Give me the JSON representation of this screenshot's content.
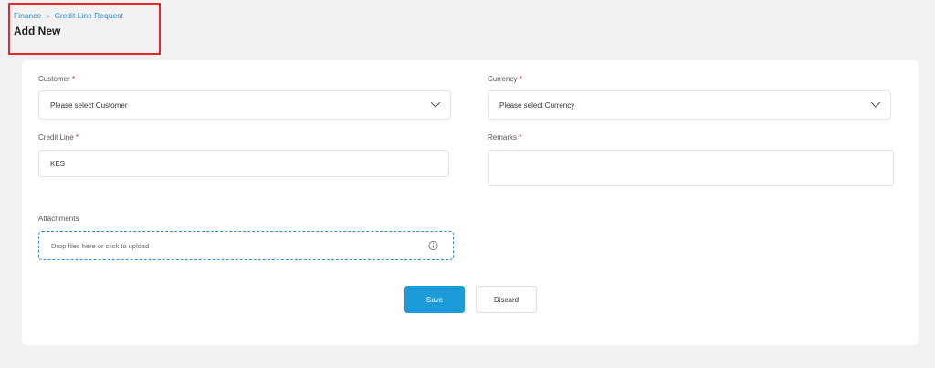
{
  "breadcrumb": {
    "root": "Finance",
    "separator": "»",
    "current": "Credit Line Request"
  },
  "page": {
    "title": "Add New"
  },
  "form": {
    "customer": {
      "label": "Customer",
      "required": "*",
      "value": "Please select Customer"
    },
    "currency": {
      "label": "Currency",
      "required": "*",
      "value": "Please select Currency"
    },
    "credit_line": {
      "label": "Credit Line",
      "required": "*",
      "value": "KES"
    },
    "remarks": {
      "label": "Remarks",
      "required": "*",
      "value": ""
    },
    "attachments": {
      "label": "Attachments",
      "placeholder": "Drop files here or click to upload",
      "icon": "info-icon"
    }
  },
  "actions": {
    "save": "Save",
    "discard": "Discard"
  },
  "colors": {
    "accent": "#1d9bd8",
    "link": "#2b8fd6",
    "required": "#e8262c",
    "highlight_border": "#e8262c"
  }
}
